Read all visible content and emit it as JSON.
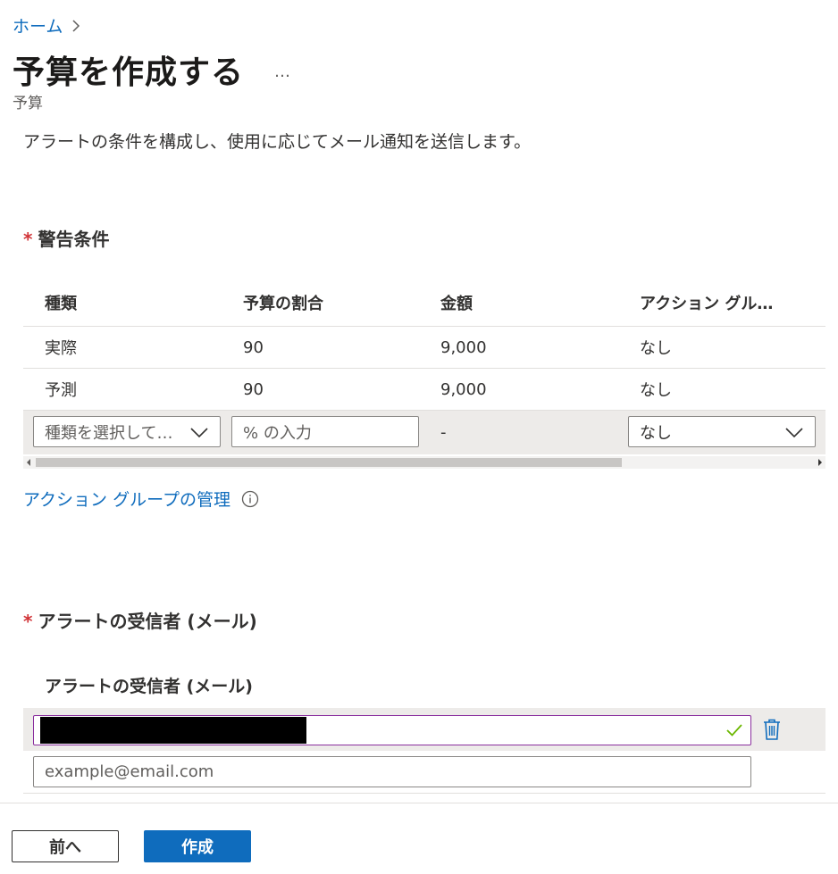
{
  "breadcrumb": {
    "home": "ホーム"
  },
  "header": {
    "title": "予算を作成する",
    "more": "…",
    "subtitle": "予算"
  },
  "description": "アラートの条件を構成し、使用に応じてメール通知を送信します。",
  "alert_conditions": {
    "required_mark": "*",
    "title": "警告条件",
    "columns": [
      "種類",
      "予算の割合",
      "金額",
      "アクション グル…"
    ],
    "rows": [
      [
        "実際",
        "90",
        "9,000",
        "なし"
      ],
      [
        "予測",
        "90",
        "9,000",
        "なし"
      ]
    ],
    "new_row": {
      "type_placeholder": "種類を選択して…",
      "percent_placeholder": "% の入力",
      "amount": "-",
      "action_group_value": "なし"
    }
  },
  "manage_action_groups": "アクション グループの管理",
  "recipients": {
    "required_mark": "*",
    "title": "アラートの受信者 (メール)",
    "column_header": "アラートの受信者 (メール)",
    "email_placeholder": "example@email.com"
  },
  "footer": {
    "prev_label": "前へ",
    "create_label": "作成"
  },
  "colors": {
    "accent": "#0f6cbd",
    "required": "#d13438",
    "valid": "#6bb700",
    "focus_border": "#8a2f9e"
  },
  "icons": [
    "chevron-right-icon",
    "chevron-down-icon",
    "info-icon",
    "checkmark-icon",
    "trash-icon"
  ]
}
